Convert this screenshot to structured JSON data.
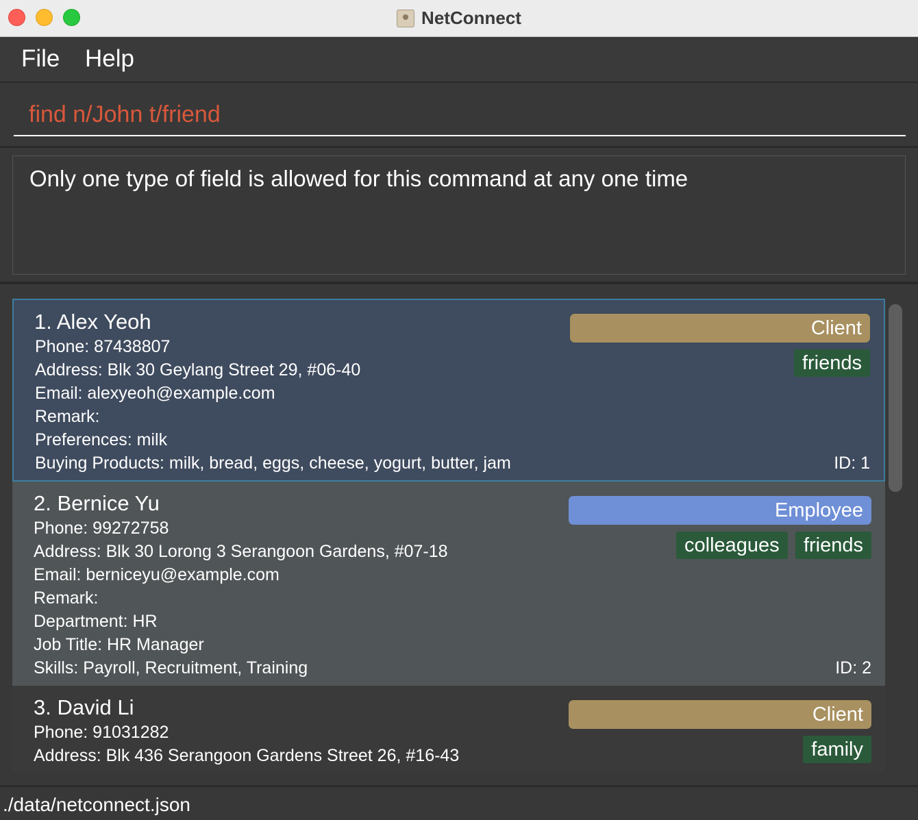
{
  "window": {
    "title": "NetConnect"
  },
  "menu": {
    "file": "File",
    "help": "Help"
  },
  "command": {
    "value": "find n/John t/friend"
  },
  "result": {
    "message": "Only one type of field is allowed for this command at any one time"
  },
  "colors": {
    "client": "#a89060",
    "employee": "#6f8fd6",
    "tag": "#2a5a3a",
    "command_error": "#d9583b"
  },
  "persons": [
    {
      "name": "1.  Alex Yeoh",
      "role": "Client",
      "tags": [
        "friends"
      ],
      "fields": [
        "Phone: 87438807",
        "Address: Blk 30 Geylang Street 29, #06-40",
        "Email: alexyeoh@example.com",
        "Remark:",
        "Preferences: milk",
        "Buying Products: milk, bread, eggs, cheese, yogurt, butter, jam"
      ],
      "id": "ID: 1"
    },
    {
      "name": "2.  Bernice Yu",
      "role": "Employee",
      "tags": [
        "colleagues",
        "friends"
      ],
      "fields": [
        "Phone: 99272758",
        "Address: Blk 30 Lorong 3 Serangoon Gardens, #07-18",
        "Email: berniceyu@example.com",
        "Remark:",
        "Department: HR",
        "Job Title: HR Manager",
        "Skills: Payroll, Recruitment, Training"
      ],
      "id": "ID: 2"
    },
    {
      "name": "3.  David Li",
      "role": "Client",
      "tags": [
        "family"
      ],
      "fields": [
        "Phone: 91031282",
        "Address: Blk 436 Serangoon Gardens Street 26, #16-43"
      ]
    }
  ],
  "status": {
    "path": "./data/netconnect.json"
  }
}
